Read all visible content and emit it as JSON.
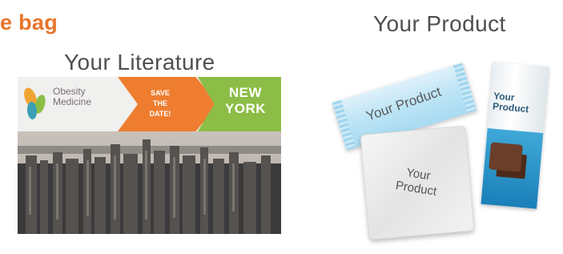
{
  "heading": "e bag",
  "literature": {
    "label": "Your Literature",
    "flyer": {
      "logo_line1": "Obesity",
      "logo_line2": "Medicine",
      "save_line1": "SAVE",
      "save_line2": "THE",
      "save_line3": "DATE!",
      "city": "NEW YORK"
    }
  },
  "products": {
    "label": "Your Product",
    "bar_text": "Your Product",
    "carton_line1": "Your",
    "carton_line2": "Product",
    "pouch_line1": "Your",
    "pouch_line2": "Product"
  },
  "colors": {
    "accent": "#e8762c",
    "flyer_orange": "#ee7d2f",
    "flyer_green": "#8cbd46"
  }
}
